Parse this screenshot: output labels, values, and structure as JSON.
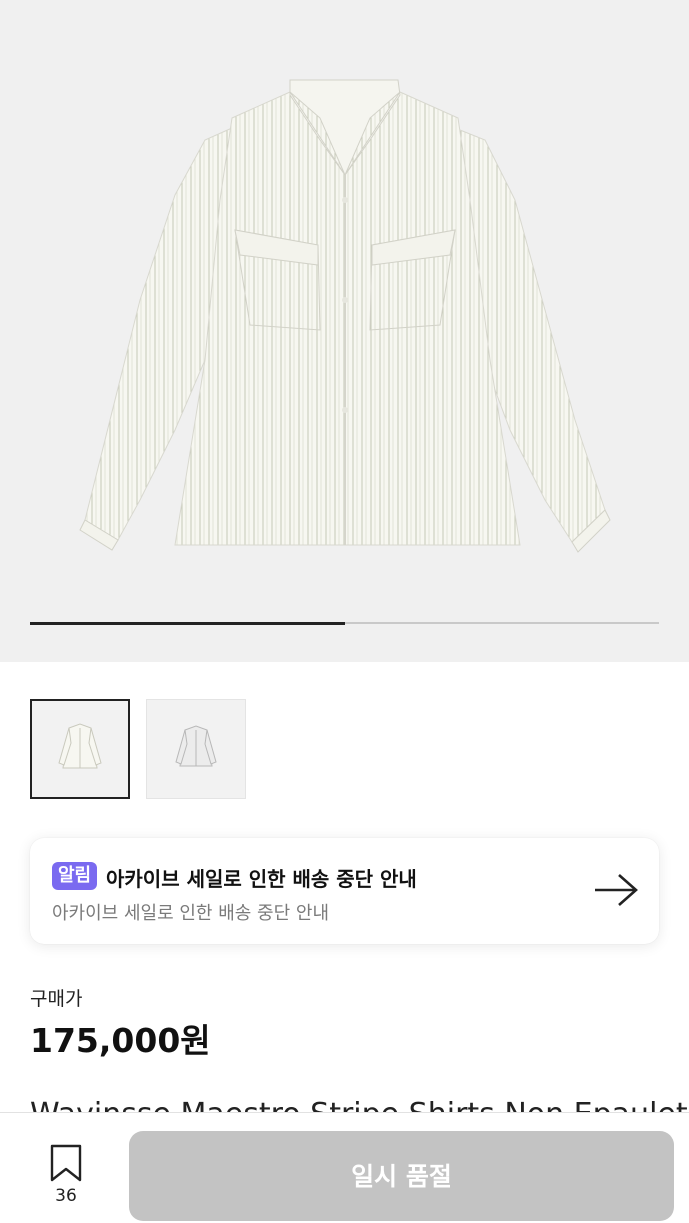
{
  "gallery": {
    "progress_fraction": 0.5,
    "thumbnails": [
      {
        "alt": "shirt-front-thumbnail",
        "active": true
      },
      {
        "alt": "shirt-alt-thumbnail",
        "active": false
      }
    ]
  },
  "notice": {
    "badge": "알림",
    "title": "아카이브 세일로 인한 배송 중단 안내",
    "subtitle": "아카이브 세일로 인한 배송 중단 안내",
    "icon": "arrow-right-icon"
  },
  "price": {
    "label": "구매가",
    "value": "175,000원"
  },
  "product": {
    "title_partial": "Wavinsse Maestro Stripe Shirts Non Epaulet"
  },
  "bottom_bar": {
    "bookmark_icon": "bookmark-icon",
    "bookmark_count": "36",
    "buy_button_label": "일시 품절"
  },
  "colors": {
    "badge": "#7a6af0",
    "button_disabled": "#c3c3c3",
    "hero_background": "#f0f0f0"
  }
}
